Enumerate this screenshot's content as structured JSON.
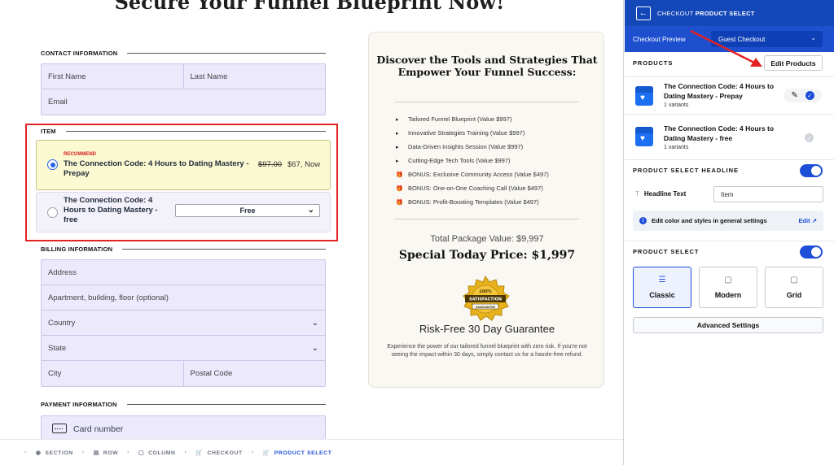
{
  "page": {
    "title": "Secure Your Funnel Blueprint Now!"
  },
  "form": {
    "contact_heading": "CONTACT INFORMATION",
    "first_name": "First Name",
    "last_name": "Last Name",
    "email": "Email",
    "item_heading": "ITEM",
    "options": [
      {
        "badge": "RECOMMEND",
        "title": "The Connection Code: 4 Hours to Dating Mastery - Prepay",
        "price_old": "$97.00",
        "price_new": "$67, Now",
        "selected": true
      },
      {
        "title": "The Connection Code: 4 Hours to Dating Mastery - free",
        "select_value": "Free",
        "selected": false
      }
    ],
    "billing_heading": "BILLING INFORMATION",
    "address": "Address",
    "apartment": "Apartment, building, floor (optional)",
    "country": "Country",
    "state": "State",
    "city": "City",
    "postal_code": "Postal Code",
    "payment_heading": "PAYMENT INFORMATION",
    "card_number": "Card number"
  },
  "sales": {
    "heading": "Discover the Tools and Strategies That Empower Your Funnel Success:",
    "benefits": [
      {
        "icon": "triangle-bullet",
        "text": "Tailored Funnel Blueprint (Value $997)"
      },
      {
        "icon": "triangle-bullet",
        "text": "Innovative Strategies Training (Value $997)"
      },
      {
        "icon": "triangle-bullet",
        "text": "Data-Driven Insights Session (Value $997)"
      },
      {
        "icon": "triangle-bullet",
        "text": "Cutting-Edge Tech Tools (Value $997)"
      },
      {
        "icon": "gift-icon",
        "text": "BONUS: Exclusive Community Access (Value $497)"
      },
      {
        "icon": "gift-icon",
        "text": "BONUS: One-on-One Coaching Call (Value $497)"
      },
      {
        "icon": "gift-icon",
        "text": "BONUS: Profit-Boosting Templates (Value $497)"
      }
    ],
    "total": "Total Package Value: $9,997",
    "special": "Special Today Price: $1,997",
    "badge_top": "100%",
    "badge_mid": "SATISFACTION",
    "badge_bottom": "GUARANTEE",
    "guarantee_title": "Risk-Free 30 Day Guarantee",
    "guarantee_text": "Experience the power of our tailored funnel blueprint with zero risk. If you're not seeing the impact within 30 days, simply contact us for a hassle-free refund."
  },
  "breadcrumb": {
    "items": [
      "SECTION",
      "ROW",
      "COLUMN",
      "CHECKOUT",
      "PRODUCT SELECT"
    ],
    "active_index": 4
  },
  "panel": {
    "title_prefix": "CHECKOUT ",
    "title_bold": "PRODUCT SELECT",
    "preview_label": "Checkout Preview",
    "preview_value": "Guest Checkout",
    "products_heading": "PRODUCTS",
    "edit_products": "Edit Products",
    "products": [
      {
        "name": "The Connection Code: 4 Hours to Dating Mastery - Prepay",
        "variants": "1 variants",
        "checked": true
      },
      {
        "name": "The Connection Code: 4 Hours to Dating Mastery - free",
        "variants": "1 variants",
        "checked": false
      }
    ],
    "headline_heading": "PRODUCT SELECT HEADLINE",
    "headline_toggle": true,
    "headline_label": "Headline Text",
    "headline_value": "Item",
    "info_text": "Edit color and styles in general settings",
    "info_link": "Edit ↗",
    "product_select_heading": "PRODUCT SELECT",
    "product_select_toggle": true,
    "layouts": [
      {
        "label": "Classic",
        "icon": "list-icon",
        "selected": true
      },
      {
        "label": "Modern",
        "icon": "square-icon",
        "selected": false
      },
      {
        "label": "Grid",
        "icon": "square-icon",
        "selected": false
      }
    ],
    "advanced": "Advanced Settings"
  },
  "colors": {
    "panel_header": "#1447b8",
    "accent": "#1d4ed8",
    "highlight_outline": "#e32222",
    "field_bg": "#ebe9fb"
  }
}
